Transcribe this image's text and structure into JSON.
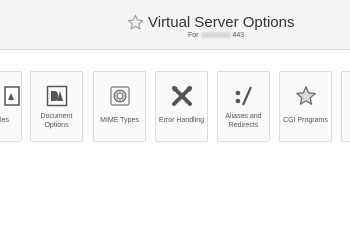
{
  "header": {
    "title": "Virtual Server Options",
    "subtitle_prefix": "For",
    "subtitle_port": "443"
  },
  "tiles": [
    {
      "label": "les",
      "icon": "file-icon"
    },
    {
      "label": "Document Options",
      "icon": "document-options-icon"
    },
    {
      "label": "MIME Types",
      "icon": "mime-types-icon"
    },
    {
      "label": "Error Handling",
      "icon": "error-handling-icon"
    },
    {
      "label": "Aliases and Redirects",
      "icon": "aliases-redirects-icon"
    },
    {
      "label": "CGI Programs",
      "icon": "cgi-star-icon"
    }
  ],
  "colors": {
    "header_bg": "#f5f5f5",
    "tile_bg": "#fafafa",
    "tile_border": "#dcdcdc",
    "icon": "#555555"
  }
}
